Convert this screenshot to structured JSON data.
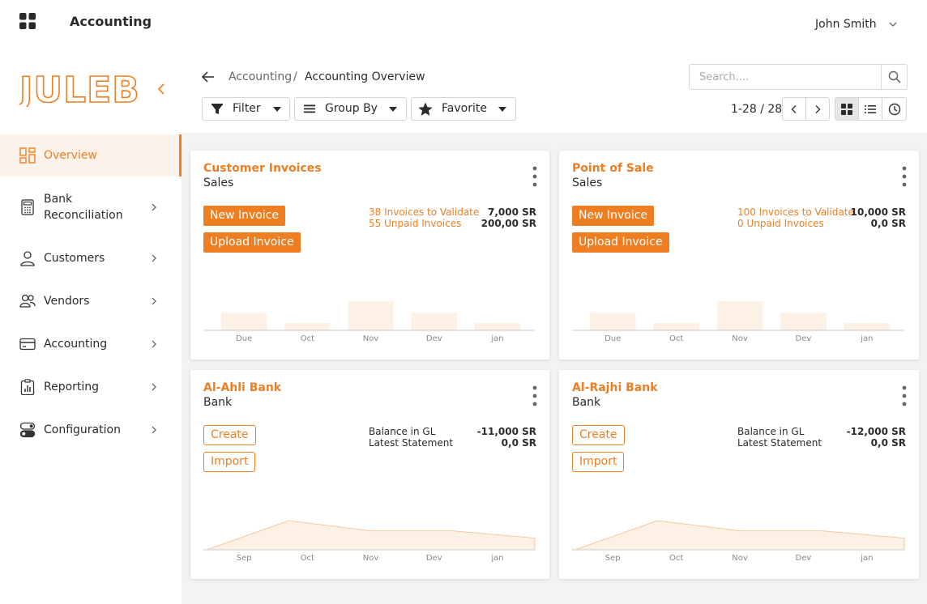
{
  "topbar": {
    "title": "Accounting",
    "user": "John Smith"
  },
  "sidebar": {
    "logo_text": "JULEB",
    "items": [
      {
        "label": "Overview",
        "icon": "dashboard-icon",
        "active": true
      },
      {
        "label": "Bank\nReconciliation",
        "icon": "calculator-icon"
      },
      {
        "label": "Customers",
        "icon": "user-icon"
      },
      {
        "label": "Vendors",
        "icon": "users-icon"
      },
      {
        "label": "Accounting",
        "icon": "card-icon"
      },
      {
        "label": "Reporting",
        "icon": "clipboard-chart-icon"
      },
      {
        "label": "Configuration",
        "icon": "toggle-icon"
      }
    ]
  },
  "breadcrumb": {
    "parent": "Accounting",
    "separator": "/",
    "current": "Accounting Overview"
  },
  "search": {
    "placeholder": "Search...."
  },
  "toolbar": {
    "filter": "Filter",
    "group_by": "Group By",
    "favorite": "Favorite"
  },
  "pager": {
    "text": "1-28 / 28"
  },
  "cards": [
    {
      "title": "Customer Invoices",
      "subtitle": "Sales",
      "btn1": "New Invoice",
      "btn2": "Upload Invoice",
      "stat1_label": "38 Invoices to Validate",
      "stat1_value": "7,000 SR",
      "stat2_label": "55 Unpaid Invoices",
      "stat2_value": "200,00 SR"
    },
    {
      "title": "Point of Sale",
      "subtitle": "Sales",
      "btn1": "New Invoice",
      "btn2": "Upload Invoice",
      "stat1_label": "100 Invoices to Validate",
      "stat1_value": "10,000 SR",
      "stat2_label": "0 Unpaid Invoices",
      "stat2_value": "0,0 SR"
    },
    {
      "title": "Al-Ahli Bank",
      "subtitle": "Bank",
      "btn1": "Create",
      "btn2": "Import",
      "stat1_label": "Balance in GL",
      "stat1_value": "-11,000 SR",
      "stat2_label": "Latest Statement",
      "stat2_value": "0,0 SR"
    },
    {
      "title": "Al-Rajhi Bank",
      "subtitle": "Bank",
      "btn1": "Create",
      "btn2": "Import",
      "stat1_label": "Balance in GL",
      "stat1_value": "-12,000 SR",
      "stat2_label": "Latest Statement",
      "stat2_value": "0,0 SR"
    }
  ],
  "chart_data": [
    {
      "type": "bar",
      "categories": [
        "Due",
        "Oct",
        "Nov",
        "Dev",
        "jan"
      ],
      "values": [
        0.6,
        0.25,
        1.0,
        0.6,
        0.25
      ]
    },
    {
      "type": "bar",
      "categories": [
        "Due",
        "Oct",
        "Nov",
        "Dev",
        "jan"
      ],
      "values": [
        0.6,
        0.25,
        1.0,
        0.6,
        0.25
      ]
    },
    {
      "type": "area",
      "categories": [
        "Sep",
        "Oct",
        "Nov",
        "Dev",
        "jan"
      ],
      "values": [
        0.0,
        1.0,
        0.65,
        0.65,
        0.4
      ]
    },
    {
      "type": "area",
      "categories": [
        "Sep",
        "Oct",
        "Nov",
        "Dev",
        "jan"
      ],
      "values": [
        0.0,
        1.0,
        0.65,
        0.65,
        0.4
      ]
    }
  ],
  "colors": {
    "accent": "#ef7e23",
    "chart_fill": "#fdf0e4",
    "active_bg": "#fdf3ea"
  }
}
